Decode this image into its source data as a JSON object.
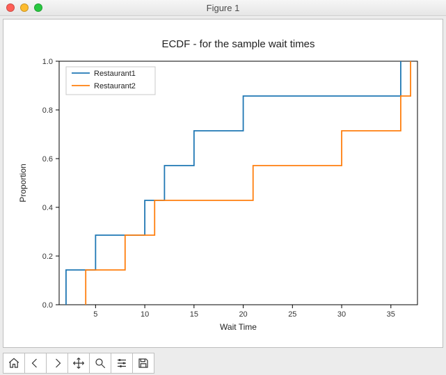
{
  "window": {
    "title": "Figure 1"
  },
  "chart_data": {
    "type": "line",
    "title": "ECDF - for the sample wait times",
    "xlabel": "Wait Time",
    "ylabel": "Proportion",
    "xlim": [
      1.3,
      37.7
    ],
    "ylim": [
      0.0,
      1.0
    ],
    "xticks": [
      5,
      10,
      15,
      20,
      25,
      30,
      35
    ],
    "yticks": [
      0.0,
      0.2,
      0.4,
      0.6,
      0.8,
      1.0
    ],
    "legend_position": "upper-left",
    "series": [
      {
        "name": "Restaurant1",
        "color": "#1f77b4",
        "steps_x": [
          2,
          5,
          10,
          12,
          15,
          20,
          35,
          36
        ],
        "steps_y": [
          0.142857,
          0.285714,
          0.428571,
          0.571429,
          0.714286,
          0.857143,
          0.857143,
          1.0
        ]
      },
      {
        "name": "Restaurant2",
        "color": "#ff7f0e",
        "steps_x": [
          4,
          8,
          11,
          19,
          21,
          30,
          36,
          37
        ],
        "steps_y": [
          0.142857,
          0.285714,
          0.428571,
          0.428571,
          0.571429,
          0.714286,
          0.857143,
          1.0
        ]
      }
    ]
  },
  "toolbar": {
    "home": "Home",
    "back": "Back",
    "forward": "Forward",
    "pan": "Pan",
    "zoom": "Zoom",
    "configure": "Configure subplots",
    "save": "Save"
  }
}
